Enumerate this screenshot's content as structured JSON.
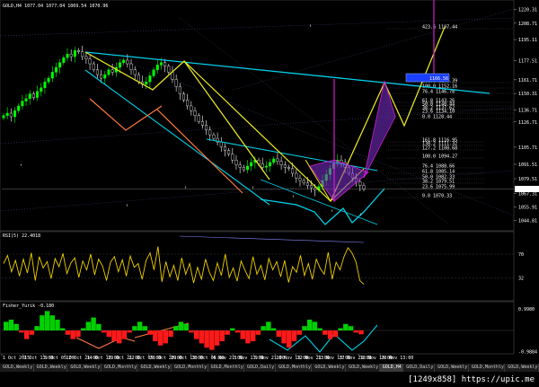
{
  "chart_data": [
    {
      "type": "candlestick",
      "title": "GOLD,H4 1077.04 1077.04 1069.54 1070.96",
      "symbol": "GOLD,H4",
      "ohlc_header": "1077.04 1077.04 1069.54 1070.96",
      "ylim": [
        1040,
        1225
      ],
      "y_ticks": [
        "1220.31",
        "1208.71",
        "1195.11",
        "1177.51",
        "1161.71",
        "1150.31",
        "1136.71",
        "1126.71",
        "1105.71",
        "1091.51",
        "1079.51",
        "1067.31",
        "1055.91",
        "1044.81"
      ],
      "current_price": "1070.96",
      "fib_levels": [
        "423.6 1197.44",
        "261.8 1166.39",
        "100.0 1152.16",
        "76.4 1146.78",
        "61.8 1143.26",
        "50.0 1140.44",
        "38.2 1137.62",
        "23.6 1134.10",
        "0.0 1128.44"
      ],
      "lower_fib_levels": [
        "161.8 1116.95",
        "138.2 1111.32",
        "127.2 1108.68",
        "100.0 1094.27",
        "76.4 1088.66",
        "61.8 1085.14",
        "50.0 1082.33",
        "38.2 1079.51",
        "23.6 1075.99",
        "0.0 1070.33"
      ],
      "x_ticks": [
        "1 Oct 2015",
        "7 Oct 13:00",
        "9 Oct 05:00",
        "12 Oct 21:00",
        "14 Oct 13:00",
        "19 Oct 21:00",
        "22 Oct 05:00",
        "26 Oct 20:00",
        "29 Oct 13:00",
        "30 Oct 05:00",
        "4 Nov 21:00",
        "5 Nov 13:00",
        "9 Nov 21:00",
        "10 Nov 13:00",
        "12 Nov 21:00",
        "13 Nov 13:00",
        "17 Nov 21:00",
        "18 Nov 13:00",
        "20 Nov 13:00"
      ],
      "close_series": [
        1132,
        1134,
        1131,
        1136,
        1140,
        1144,
        1146,
        1150,
        1147,
        1152,
        1155,
        1160,
        1163,
        1168,
        1172,
        1176,
        1180,
        1183,
        1181,
        1186,
        1185,
        1181,
        1179,
        1175,
        1170,
        1166,
        1163,
        1166,
        1170,
        1168,
        1172,
        1176,
        1178,
        1175,
        1170,
        1166,
        1160,
        1158,
        1160,
        1165,
        1170,
        1174,
        1176,
        1173,
        1168,
        1162,
        1156,
        1150,
        1145,
        1140,
        1136,
        1132,
        1127,
        1124,
        1120,
        1116,
        1113,
        1110,
        1106,
        1103,
        1100,
        1095,
        1091,
        1089,
        1087,
        1090,
        1093,
        1095,
        1092,
        1089,
        1090,
        1093,
        1096,
        1094,
        1091,
        1089,
        1088,
        1084,
        1080,
        1078,
        1076,
        1074,
        1072,
        1070,
        1073,
        1078,
        1083,
        1088,
        1092,
        1095,
        1093,
        1089,
        1084,
        1080,
        1077,
        1074,
        1071
      ]
    },
    {
      "type": "line",
      "title": "RSI(5) 22.4018",
      "indicator_label": "RSI(5) 22.4018",
      "ylim": [
        0,
        100
      ],
      "y_ticks": [
        "70",
        "32"
      ],
      "values": [
        55,
        68,
        42,
        60,
        35,
        62,
        40,
        72,
        28,
        66,
        48,
        58,
        31,
        63,
        50,
        71,
        39,
        56,
        64,
        33,
        59,
        45,
        70,
        37,
        62,
        51,
        28,
        57,
        66,
        42,
        61,
        35,
        67,
        49,
        55,
        30,
        60,
        72,
        45,
        82,
        26,
        58,
        34,
        52,
        28,
        64,
        38,
        55,
        24,
        49,
        30,
        62,
        41,
        28,
        56,
        36,
        70,
        33,
        48,
        27,
        59,
        44,
        31,
        66,
        38,
        52,
        29,
        63,
        45,
        58,
        34,
        60,
        25,
        50,
        41,
        68,
        36,
        55,
        30,
        62,
        47,
        38,
        73,
        30,
        57,
        45,
        66,
        80,
        72,
        58,
        28,
        22
      ]
    },
    {
      "type": "bar",
      "title": "Fisher_Yurik -0.180",
      "indicator_label": "Fisher_Yurik -0.180",
      "ylim": [
        -1,
        1
      ],
      "y_ticks": [
        "0.9980",
        "-0.9884"
      ],
      "values": [
        0.4,
        0.5,
        0.3,
        -0.1,
        -0.4,
        -0.2,
        0.2,
        0.7,
        0.9,
        0.7,
        0.5,
        0.1,
        -0.2,
        -0.4,
        -0.3,
        0.1,
        0.4,
        0.6,
        0.3,
        -0.1,
        -0.3,
        -0.5,
        -0.6,
        -0.4,
        -0.1,
        0.2,
        0.4,
        0.2,
        -0.2,
        -0.5,
        -0.7,
        -0.6,
        -0.3,
        0.2,
        0.4,
        0.3,
        -0.1,
        -0.4,
        -0.6,
        -0.8,
        -0.9,
        -0.7,
        -0.5,
        -0.2,
        0.1,
        -0.1,
        -0.4,
        -0.6,
        -0.5,
        -0.2,
        0.2,
        0.4,
        0.1,
        -0.3,
        -0.6,
        -0.8,
        -0.5,
        -0.2,
        0.2,
        0.5,
        0.4,
        0.1,
        -0.2,
        -0.4,
        -0.3,
        0.1,
        0.3,
        0.2,
        -0.1,
        -0.18
      ]
    }
  ],
  "chart": {
    "symbol_caption": "GOLD,H4 1077.04 1077.04 1069.54 1070.96",
    "rsi_caption": "RSI(5) 22.4018",
    "fisher_caption": "Fisher_Yurik -0.180",
    "current_price": "1070.96",
    "fib_tag": "1166.56"
  },
  "tabs": [
    {
      "label": "GOLD,Weekly",
      "active": false
    },
    {
      "label": "GOLD,Weekly",
      "active": false
    },
    {
      "label": "GOLD,Weekly",
      "active": false
    },
    {
      "label": "GOLD,Monthly",
      "active": false
    },
    {
      "label": "GOLD,Weekly",
      "active": false
    },
    {
      "label": "GOLD,Monthly",
      "active": false
    },
    {
      "label": "GOLD,Monthly",
      "active": false
    },
    {
      "label": "GOLD,Daily",
      "active": false
    },
    {
      "label": "GOLD,Monthly",
      "active": false
    },
    {
      "label": "GOLD,Weekly",
      "active": false
    },
    {
      "label": "GOLD,Weekly",
      "active": false
    },
    {
      "label": "GOLD,H4",
      "active": true
    },
    {
      "label": "GOLD,Daily",
      "active": false
    },
    {
      "label": "GOLD,Weekly",
      "active": false
    },
    {
      "label": "GOLD,Monthly",
      "active": false
    },
    {
      "label": "GOLD,Weekly",
      "active": false
    }
  ],
  "watermark": "[1249x858] https://upic.me",
  "colors": {
    "bull": "#00ff00",
    "bear": "#ffffff",
    "rsi_line": "#f0d000",
    "fisher_up": "#00d000",
    "fisher_down": "#ff1a1a",
    "cyan": "#00d0e8",
    "yellow": "#f0f020",
    "orange": "#ff7a40",
    "magenta": "#d020d0",
    "purple_fill": "#7b2fd0",
    "blue_box": "#1a3fff"
  }
}
